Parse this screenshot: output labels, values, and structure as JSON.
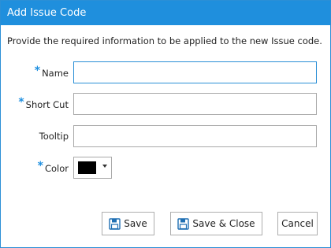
{
  "dialog": {
    "title": "Add Issue Code",
    "instructions": "Provide the required information to be applied to the new Issue code."
  },
  "fields": {
    "required_marker": "*",
    "name": {
      "label": "Name",
      "required": true,
      "value": ""
    },
    "short_cut": {
      "label": "Short Cut",
      "required": true,
      "value": ""
    },
    "tooltip": {
      "label": "Tooltip",
      "required": false,
      "value": ""
    },
    "color": {
      "label": "Color",
      "required": true,
      "value": "#000000"
    }
  },
  "buttons": {
    "save": "Save",
    "save_close": "Save & Close",
    "cancel": "Cancel"
  },
  "colors": {
    "title_bar": "#1f8fdd",
    "required_marker": "#1e8fe0",
    "border": "#a9a9a9",
    "focus_border": "#2a8fd6"
  }
}
